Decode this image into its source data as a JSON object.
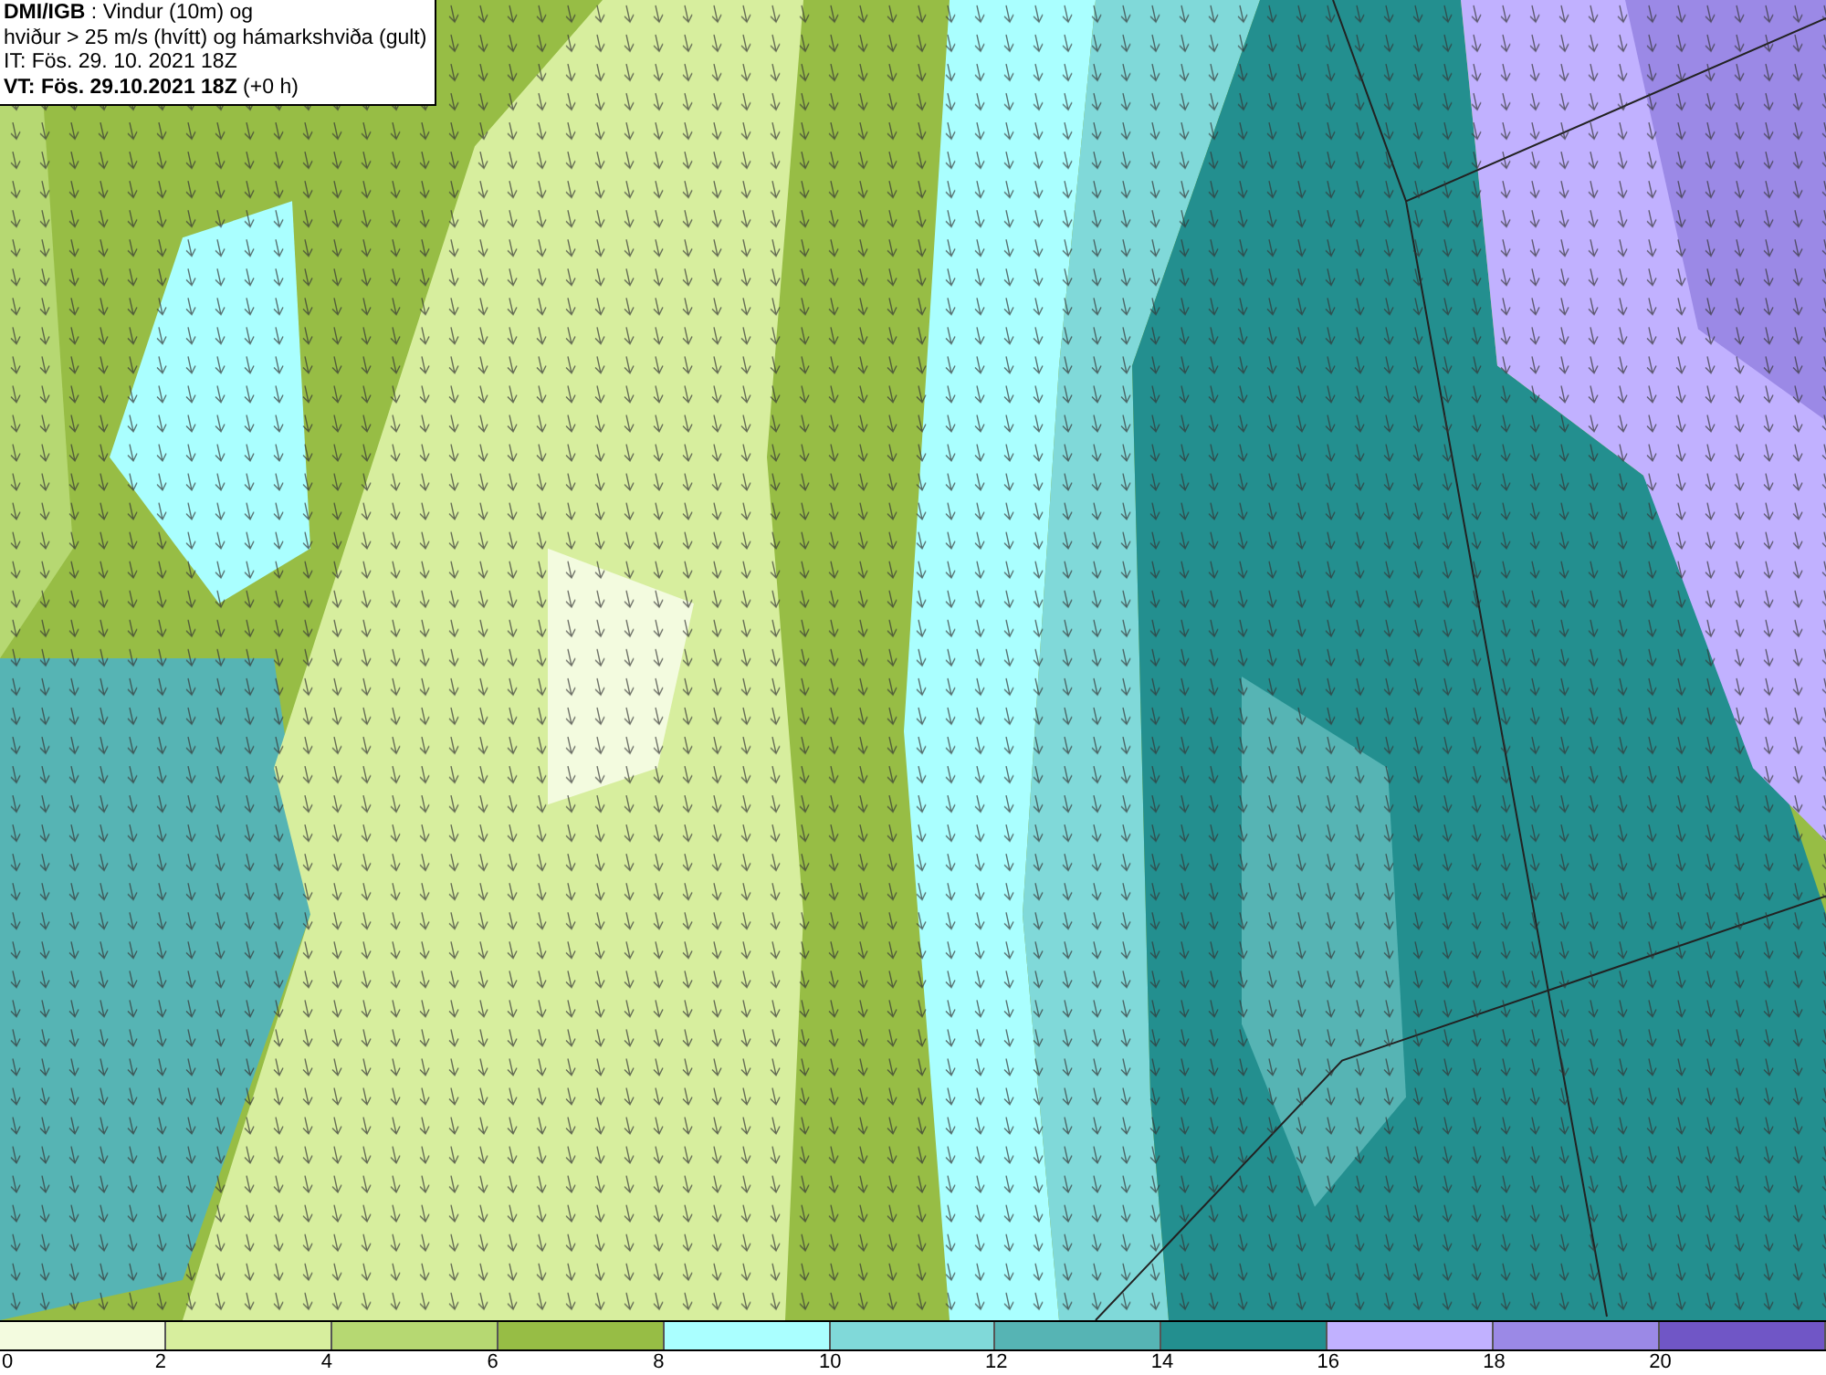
{
  "title_box": {
    "lines": [
      "**DMI/IGB** : Vindur (10m) og",
      "hviður > 25 m/s (hvítt) og hámarkshviða (gult)",
      "IT: Fös. 29. 10. 2021 18Z",
      "**VT: Fös. 29.10.2021 18Z** (+0 h)"
    ]
  },
  "legend": {
    "segments": [
      {
        "color": "#f3fbdf"
      },
      {
        "color": "#d7ee9e"
      },
      {
        "color": "#b6d872"
      },
      {
        "color": "#97bd45"
      },
      {
        "color": "#aaffff"
      },
      {
        "color": "#80d9d9"
      },
      {
        "color": "#56b4b4"
      },
      {
        "color": "#238f8f"
      },
      {
        "color": "#c1b1ff"
      },
      {
        "color": "#9b89e6"
      },
      {
        "color": "#7056c6"
      }
    ],
    "ticks": [
      "0",
      "2",
      "4",
      "6",
      "8",
      "10",
      "12",
      "14",
      "16",
      "18",
      "20"
    ]
  }
}
